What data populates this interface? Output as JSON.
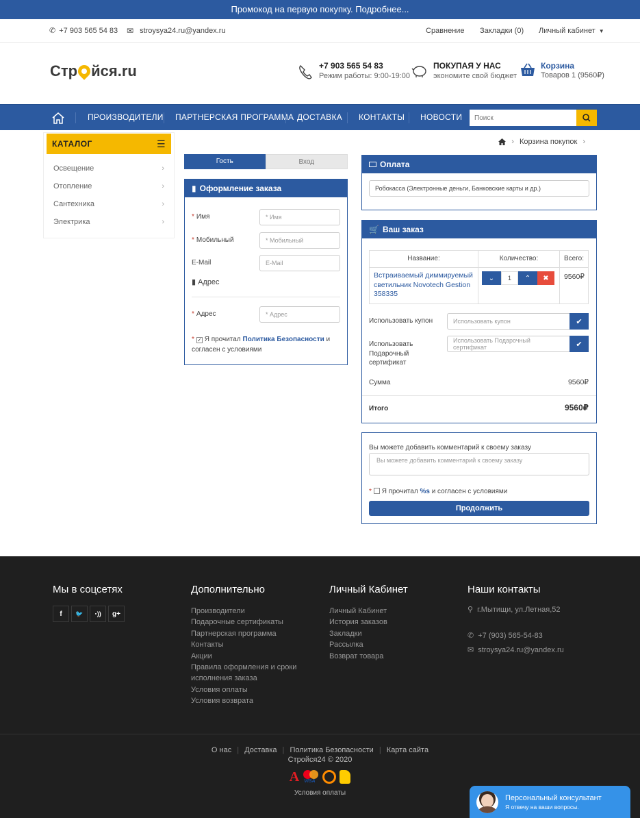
{
  "promo": "Промокод на первую покупку. Подробнее...",
  "topbar": {
    "phone": "+7 903 565 54 83",
    "email": "stroysya24.ru@yandex.ru",
    "compare": "Сравнение",
    "bookmarks": "Закладки (0)",
    "account": "Личный кабинет"
  },
  "header": {
    "logo_pre": "Стр",
    "logo_post": "йся.ru",
    "phone": "+7 903 565 54 83",
    "hours": "Режим работы: 9:00-19:00",
    "promo_title": "ПОКУПАЯ У НАС",
    "promo_sub": "экономите свой бюджет",
    "cart_title": "Корзина",
    "cart_sub": "Товаров 1 (9560₽)"
  },
  "nav": {
    "items": [
      "ПРОИЗВОДИТЕЛИ",
      "ПАРТНЕРСКАЯ ПРОГРАММА",
      "ДОСТАВКА",
      "КОНТАКТЫ",
      "НОВОСТИ"
    ],
    "search_placeholder": "Поиск"
  },
  "catalog": {
    "title": "КАТАЛОГ",
    "items": [
      "Освещение",
      "Отопление",
      "Сантехника",
      "Электрика"
    ]
  },
  "breadcrumb": {
    "current": "Корзина покупок"
  },
  "checkout": {
    "tab_guest": "Гость",
    "tab_login": "Вход",
    "form_title": "Оформление заказа",
    "name_label": "Имя",
    "name_placeholder": "* Имя",
    "mobile_label": "Мобильный",
    "mobile_placeholder": "* Мобильный",
    "email_label": "E-Mail",
    "email_placeholder": "E-Mail",
    "address_section": "Адрес",
    "address_label": "Адрес",
    "address_placeholder": "* Адрес",
    "agree_pre": "Я прочитал",
    "agree_link": "Политика Безопасности",
    "agree_post": "и",
    "agree_line2": "согласен с условиями"
  },
  "payment": {
    "title": "Оплата",
    "method": "Робокасса (Электронные деньги, Банковские карты и др.)"
  },
  "order": {
    "title": "Ваш заказ",
    "col_name": "Название:",
    "col_qty": "Количество:",
    "col_total": "Всего:",
    "product": "Встраиваемый диммируемый светильник Novotech Gestion 358335",
    "qty": "1",
    "price": "9560₽",
    "coupon_label": "Использовать купон",
    "coupon_placeholder": "Использовать купон",
    "gift_label_1": "Использовать",
    "gift_label_2": "Подарочный",
    "gift_label_3": "сертификат",
    "gift_placeholder": "Использовать Подарочный сертификат",
    "sum_label": "Сумма",
    "sum_value": "9560₽",
    "total_label": "Итого",
    "total_value": "9560₽"
  },
  "comment": {
    "label": "Вы можете добавить комментарий к своему заказу",
    "placeholder": "Вы можете добавить комментарий к своему заказу",
    "agree_pre": "Я прочитал",
    "agree_link": "%s",
    "agree_post": "и согласен с условиями",
    "continue": "Продолжить"
  },
  "footer": {
    "social_title": "Мы в соцсетях",
    "social": [
      "f",
      "t",
      "rss",
      "g+"
    ],
    "extra_title": "Дополнительно",
    "extra_links": [
      "Производители",
      "Подарочные сертификаты",
      "Партнерская программа",
      "Контакты",
      "Акции",
      "Правила оформления и сроки",
      "исполнения заказа",
      "Условия оплаты",
      "Условия возврата"
    ],
    "account_title": "Личный Кабинет",
    "account_links": [
      "Личный Кабинет",
      "История заказов",
      "Закладки",
      "Рассылка",
      "Возврат товара"
    ],
    "contacts_title": "Наши контакты",
    "address": "г.Мытищи, ул.Летная,52",
    "phone": "+7 (903) 565-54-83",
    "email": "stroysya24.ru@yandex.ru",
    "bottom_links": [
      "О нас",
      "Доставка",
      "Политика Безопасности",
      "Карта сайта"
    ],
    "copyright": "Стройся24 © 2020",
    "pay_label": "Условия оплаты"
  },
  "consultant": {
    "title": "Персональный консультант",
    "sub": "Я отвечу на ваши вопросы."
  },
  "colors": {
    "primary": "#2c5aa0",
    "accent": "#f5b800",
    "footer": "#1f1f1f",
    "chat": "#3592e8"
  }
}
